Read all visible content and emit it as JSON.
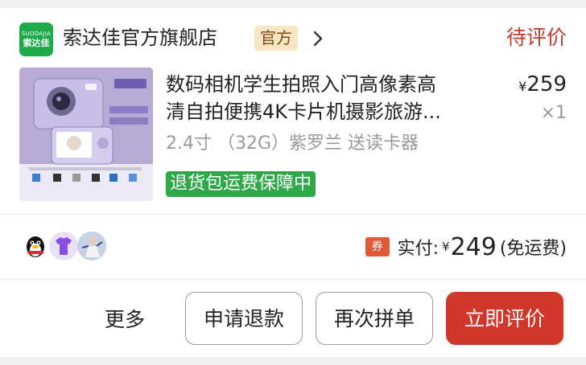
{
  "shop": {
    "logo_line1": "SUODAJIA",
    "logo_line2": "索达佳",
    "name": "索达佳官方旗舰店",
    "badge": "官方",
    "status": "待评价"
  },
  "product": {
    "title_line1": "数码相机学生拍照入门高像素高",
    "title_line2": "清自拍便携4K卡片机摄影旅游...",
    "price_symbol": "¥",
    "price": "259",
    "quantity": "×1",
    "spec": "2.4寸 （32G）紫罗兰 送读卡器",
    "guarantee": "退货包运费保障中"
  },
  "payment": {
    "coupon_icon": "券",
    "label": "实付:",
    "currency": "¥",
    "amount": "249",
    "note": "(免运费)"
  },
  "actions": {
    "more": "更多",
    "refund": "申请退款",
    "reorder": "再次拼单",
    "review": "立即评价"
  },
  "colors": {
    "accent_red": "#d2352a",
    "status_red": "#c23b2b",
    "guarantee_green": "#2fa84a",
    "logo_green": "#1eaa4a",
    "official_badge_bg": "#f7e6c3"
  },
  "icons": [
    "chevron-right-icon",
    "qq-penguin-icon",
    "tshirt-icon",
    "avatar-photo-icon",
    "coupon-icon"
  ]
}
